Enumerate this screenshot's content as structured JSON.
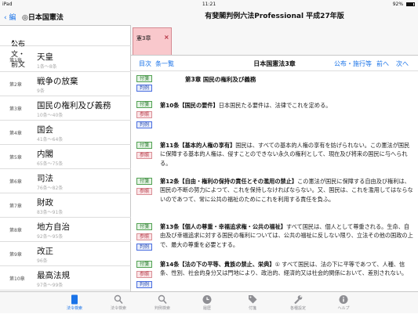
{
  "status": {
    "device": "iPad",
    "time": "11:21",
    "battery": "92%"
  },
  "left_panel": {
    "back_label": "編",
    "title": "◎日本国憲法",
    "intro": "公布文・前文",
    "chapters": [
      {
        "no": "第1章",
        "title": "天皇",
        "range": "1条〜8条"
      },
      {
        "no": "第2章",
        "title": "戦争の放棄",
        "range": "9条"
      },
      {
        "no": "第3章",
        "title": "国民の権利及び義務",
        "range": "10条〜40条"
      },
      {
        "no": "第4章",
        "title": "国会",
        "range": "41条〜64条"
      },
      {
        "no": "第5章",
        "title": "内閣",
        "range": "65条〜75条"
      },
      {
        "no": "第6章",
        "title": "司法",
        "range": "76条〜82条"
      },
      {
        "no": "第7章",
        "title": "財政",
        "range": "83条〜91条"
      },
      {
        "no": "第8章",
        "title": "地方自治",
        "range": "92条〜95条"
      },
      {
        "no": "第9章",
        "title": "改正",
        "range": "96条"
      },
      {
        "no": "第10章",
        "title": "最高法規",
        "range": "97条〜99条"
      }
    ]
  },
  "main": {
    "app_title": "有斐閣判例六法Professional 平成27年版",
    "tab_label": "憲3章",
    "tab_close": "×",
    "nav": {
      "contents": "目次",
      "article_list": "条一覧",
      "center_title": "日本国憲法3章",
      "promulgation": "公布・施行等",
      "prev": "前へ",
      "next": "次へ"
    },
    "chapter_heading": "第3章 国民の権利及び義務",
    "badges": {
      "fusen": "付箋",
      "hanrei": "判例",
      "sansho": "参照"
    },
    "articles": [
      {
        "head": "第10条【国民の要件】",
        "text": "日本国民たる要件は、法律でこれを定める。"
      },
      {
        "head": "第11条【基本的人権の享有】",
        "text": "国民は、すべての基本的人権の享有を妨げられない。この憲法が国民に保障する基本的人権は、侵すことのできない永久の権利として、現在及び将来の国民に与へられる。"
      },
      {
        "head": "第12条【自由・権利の保持の責任とその濫用の禁止】",
        "text": "この憲法が国民に保障する自由及び権利は、国民の不断の努力によつて、これを保持しなければならない。又、国民は、これを濫用してはならないのであつて、常に公共の福祉のためにこれを利用する責任を負ふ。"
      },
      {
        "head": "第13条【個人の尊重・幸福追求権・公共の福祉】",
        "text": "すべて国民は、個人として尊重される。生命、自由及び幸福追求に対する国民の権利については、公共の福祉に反しない限り、立法その他の国政の上で、最大の尊重を必要とする。"
      },
      {
        "head": "第14条【法の下の平等、貴族の禁止、栄典】",
        "text": "① すべて国民は、法の下に平等であつて、人種、信条、性別、社会的身分又は門地により、政治的、経済的又は社会的関係において、差別されない。"
      }
    ]
  },
  "bottom_tabs": [
    {
      "label": "法令検索",
      "icon": "book-icon"
    },
    {
      "label": "法令検索",
      "icon": "search-icon"
    },
    {
      "label": "判例検索",
      "icon": "search-icon"
    },
    {
      "label": "履歴",
      "icon": "clock-icon"
    },
    {
      "label": "付箋",
      "icon": "tag-icon"
    },
    {
      "label": "各種設定",
      "icon": "wrench-icon"
    },
    {
      "label": "ヘルプ",
      "icon": "info-icon"
    }
  ],
  "colors": {
    "accent": "#1a73e8",
    "tab_pink": "#f9c8cc",
    "fusen_green": "#2e7d32",
    "hanrei_blue": "#2e4fb0",
    "sansho_red": "#b23340"
  }
}
